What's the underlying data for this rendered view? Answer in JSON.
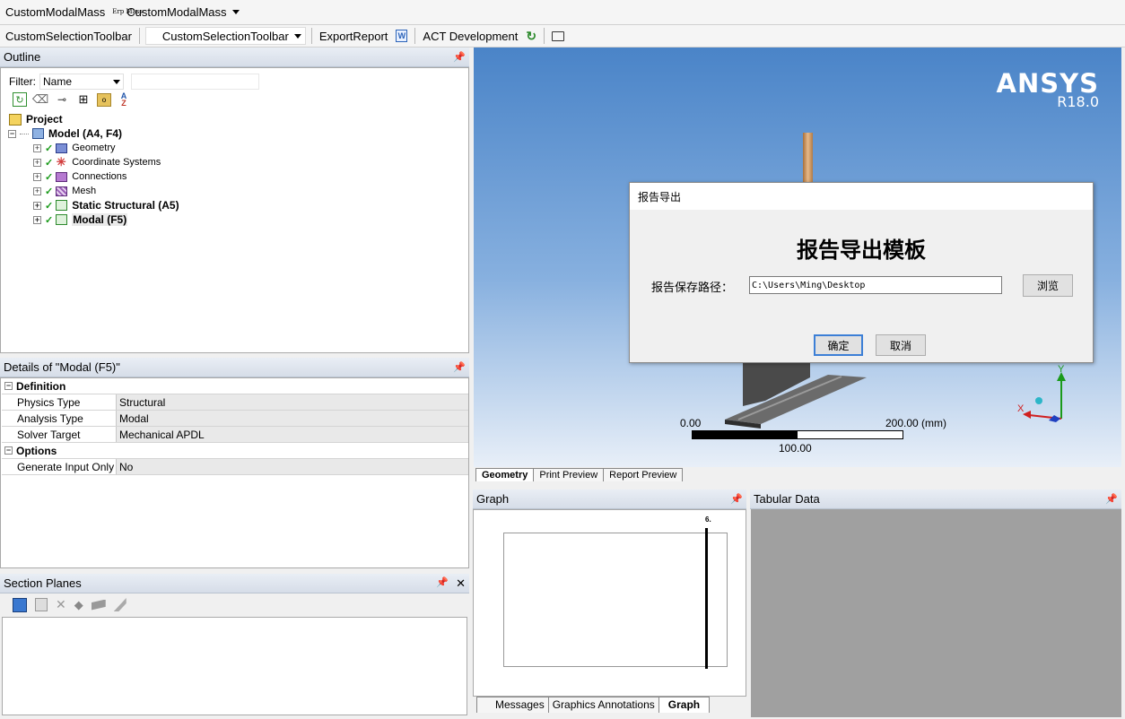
{
  "toolbar1": {
    "item1": "CustomModalMass",
    "icon_text": "Erp Mass",
    "item2": "CustomModalMass"
  },
  "toolbar2": {
    "item1": "CustomSelectionToolbar",
    "item2": "CustomSelectionToolbar",
    "export": "ExportReport",
    "act": "ACT Development"
  },
  "outline": {
    "title": "Outline",
    "filter_label": "Filter:",
    "filter_value": "Name",
    "tree": [
      {
        "label": "Project"
      },
      {
        "label": "Model (A4, F4)"
      },
      {
        "label": "Geometry"
      },
      {
        "label": "Coordinate Systems"
      },
      {
        "label": "Connections"
      },
      {
        "label": "Mesh"
      },
      {
        "label": "Static Structural (A5)"
      },
      {
        "label": "Modal (F5)"
      }
    ]
  },
  "details": {
    "title": "Details of \"Modal (F5)\"",
    "rows": [
      {
        "name": "Definition",
        "value": ""
      },
      {
        "name": "Physics Type",
        "value": "Structural"
      },
      {
        "name": "Analysis Type",
        "value": "Modal"
      },
      {
        "name": "Solver Target",
        "value": "Mechanical APDL"
      },
      {
        "name": "Options",
        "value": ""
      },
      {
        "name": "Generate Input Only",
        "value": "No"
      }
    ]
  },
  "section_planes": {
    "title": "Section Planes"
  },
  "viewport": {
    "brand": "ANSYS",
    "version": "R18.0",
    "scale_left": "0.00",
    "scale_right": "200.00 (mm)",
    "scale_mid": "100.00",
    "axis_y": "Y",
    "axis_x": "X",
    "tabs": [
      "Geometry",
      "Print Preview",
      "Report Preview"
    ]
  },
  "dialog": {
    "title": "报告导出",
    "heading": "报告导出模板",
    "path_label": "报告保存路径：",
    "path_value": "C:\\Users\\Ming\\Desktop",
    "browse": "浏览",
    "ok": "确定",
    "cancel": "取消"
  },
  "graph": {
    "title": "Graph",
    "marker_label": "6.",
    "tabs": [
      "Messages",
      "Graphics Annotations",
      "Graph"
    ]
  },
  "tabular": {
    "title": "Tabular Data"
  }
}
